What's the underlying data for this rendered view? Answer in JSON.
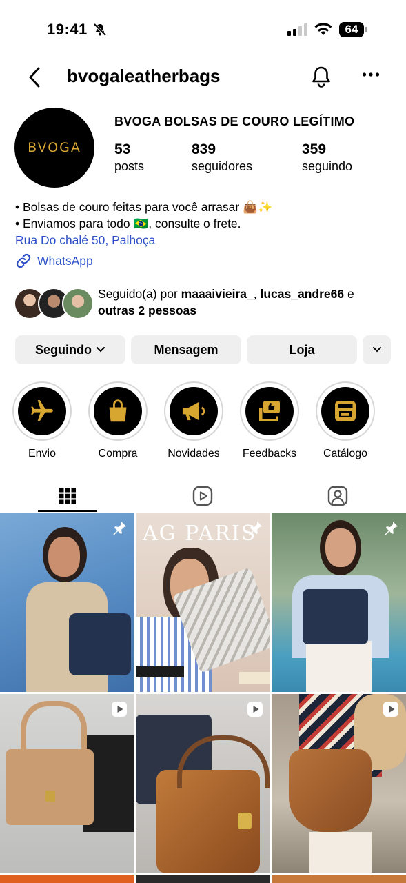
{
  "status_bar": {
    "time": "19:41",
    "battery": "64"
  },
  "header": {
    "username": "bvogaleatherbags"
  },
  "profile": {
    "avatar_text": "BVOGA",
    "display_name": "BVOGA BOLSAS DE COURO LEGÍTIMO",
    "stats": [
      {
        "value": "53",
        "label": "posts"
      },
      {
        "value": "839",
        "label": "seguidores"
      },
      {
        "value": "359",
        "label": "seguindo"
      }
    ],
    "bio_lines": [
      "• Bolsas de couro feitas para você arrasar 👜✨",
      "• Enviamos para todo 🇧🇷, consulte o frete."
    ],
    "address": "Rua Do chalé 50, Palhoça",
    "link": "WhatsApp"
  },
  "followed_by": {
    "prefix": "Seguido(a) por",
    "user1": "maaaivieira_",
    "sep": ",",
    "user2": "lucas_andre66",
    "and": "e",
    "others": "outras 2 pessoas"
  },
  "buttons": {
    "following": "Seguindo",
    "message": "Mensagem",
    "shop": "Loja"
  },
  "highlights": [
    {
      "label": "Envio",
      "icon": "airplane-icon"
    },
    {
      "label": "Compra",
      "icon": "shopping-bag-icon"
    },
    {
      "label": "Novidades",
      "icon": "megaphone-icon"
    },
    {
      "label": "Feedbacks",
      "icon": "feedback-icon"
    },
    {
      "label": "Catálogo",
      "icon": "storefront-icon"
    }
  ],
  "tabs": [
    {
      "icon": "grid-icon",
      "active": true
    },
    {
      "icon": "reels-icon",
      "active": false
    },
    {
      "icon": "tagged-icon",
      "active": false
    }
  ],
  "posts": [
    {
      "type": "pinned",
      "overlay_text": ""
    },
    {
      "type": "pinned",
      "overlay_text": "AG PARIS"
    },
    {
      "type": "pinned",
      "overlay_text": ""
    },
    {
      "type": "reel",
      "overlay_text": ""
    },
    {
      "type": "reel",
      "overlay_text": ""
    },
    {
      "type": "reel",
      "overlay_text": ""
    }
  ],
  "colors": {
    "link": "#2d4fc8",
    "button_bg": "#efefef",
    "brand_gold": "#d6a630"
  }
}
